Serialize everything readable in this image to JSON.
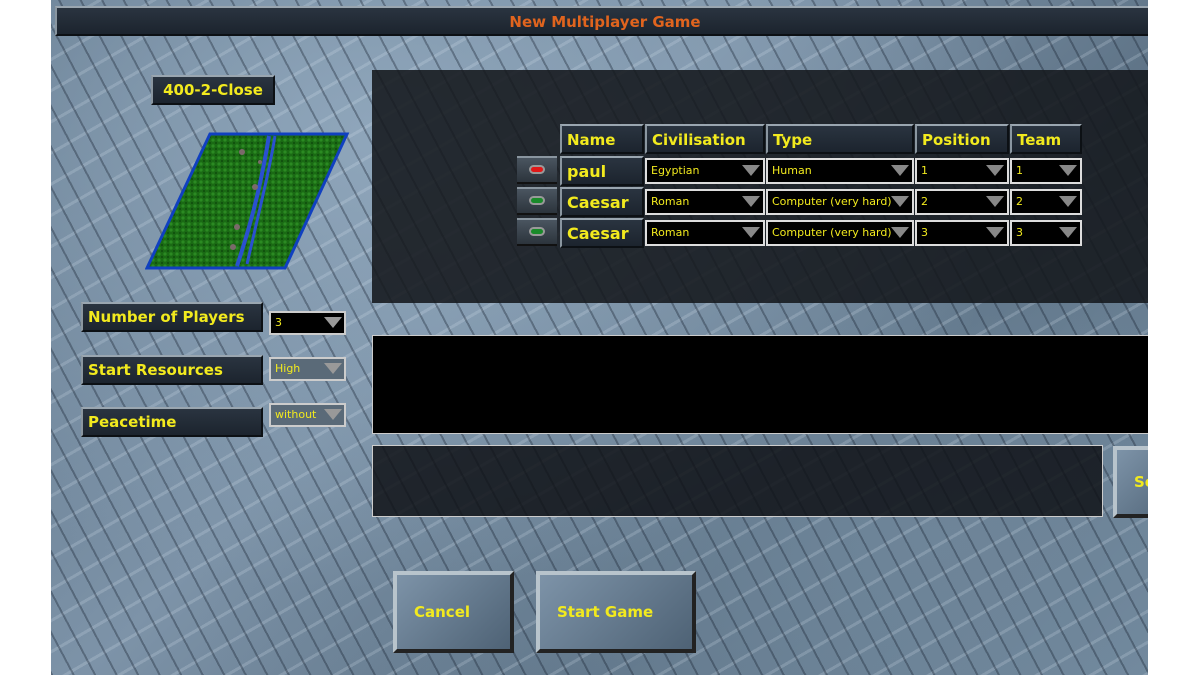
{
  "window": {
    "title": "New Multiplayer Game"
  },
  "map": {
    "name": "400-2-Close"
  },
  "settings": [
    {
      "label": "Number of Players",
      "value": "3"
    },
    {
      "label": "Start Resources",
      "value": "High"
    },
    {
      "label": "Peacetime",
      "value": "without"
    }
  ],
  "players": {
    "headers": [
      "Name",
      "Civilisation",
      "Type",
      "Position",
      "Team"
    ],
    "rows": [
      {
        "status": "red",
        "name": "paul",
        "civilisation": "Egyptian",
        "type": "Human",
        "position": "1",
        "team": "1"
      },
      {
        "status": "green",
        "name": "Caesar",
        "civilisation": "Roman",
        "type": "Computer (very hard)",
        "position": "2",
        "team": "2"
      },
      {
        "status": "green",
        "name": "Caesar",
        "civilisation": "Roman",
        "type": "Computer (very hard)",
        "position": "3",
        "team": "3"
      }
    ]
  },
  "chat": {
    "send_label": "Send"
  },
  "buttons": {
    "cancel": "Cancel",
    "start": "Start Game"
  },
  "colors": {
    "title": "#e0641e",
    "label": "#f2ea1e",
    "led_red": "#e01818",
    "led_green": "#1a8a2a"
  }
}
